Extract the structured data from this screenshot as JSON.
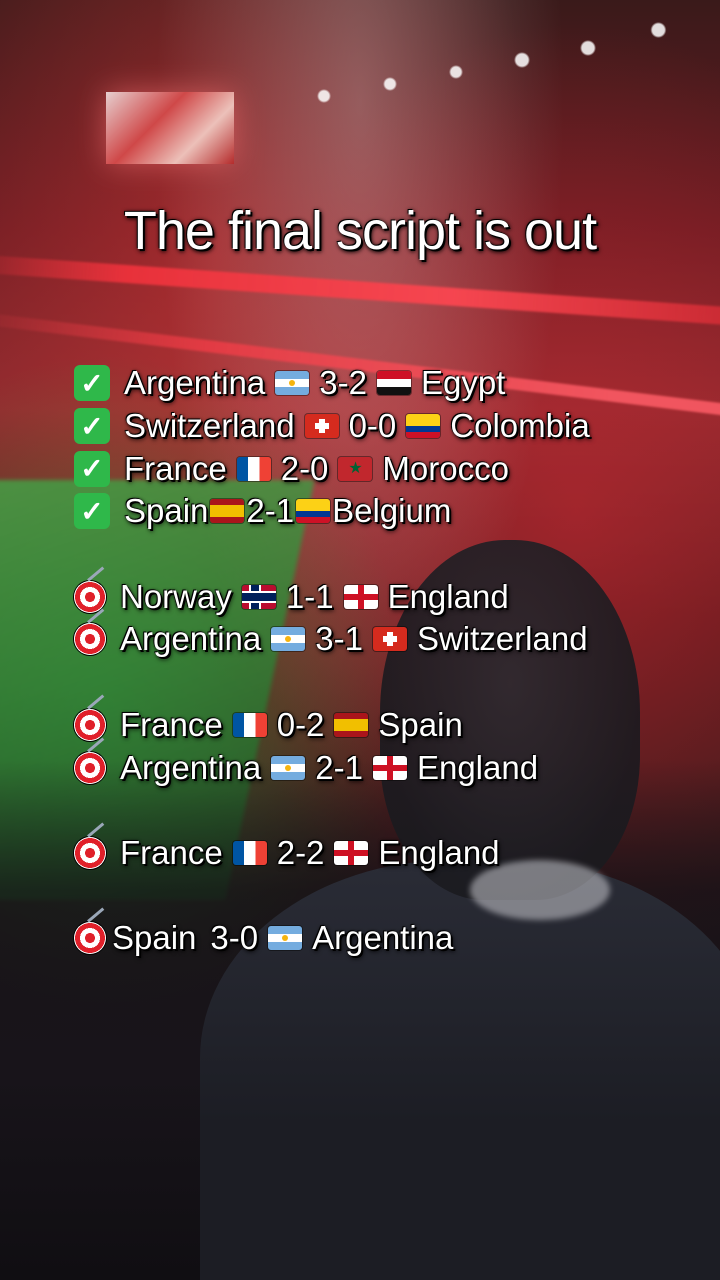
{
  "title": "The final script is out",
  "completed": [
    {
      "home": "Argentina",
      "home_flag": "flag-argentina",
      "score": "3-2",
      "away": "Egypt",
      "away_flag": "flag-egypt"
    },
    {
      "home": "Switzerland",
      "home_flag": "flag-switzerland",
      "score": "0-0",
      "away": "Colombia",
      "away_flag": "flag-colombia"
    },
    {
      "home": "France",
      "home_flag": "flag-france",
      "score": "2-0",
      "away": "Morocco",
      "away_flag": "flag-morocco"
    },
    {
      "home": "Spain",
      "home_flag": "flag-spain",
      "score": "2-1",
      "away": "Belgium",
      "away_flag": "flag-colombia"
    }
  ],
  "predictions": {
    "quarterfinals": [
      {
        "home": "Norway",
        "home_flag": "flag-norway",
        "score": "1-1",
        "away": "England",
        "away_flag": "flag-england"
      },
      {
        "home": "Argentina",
        "home_flag": "flag-argentina",
        "score": "3-1",
        "away": "Switzerland",
        "away_flag": "flag-switzerland"
      }
    ],
    "semifinals": [
      {
        "home": "France",
        "home_flag": "flag-france",
        "score": "0-2",
        "away": "Spain",
        "away_flag": "flag-spain"
      },
      {
        "home": "Argentina",
        "home_flag": "flag-argentina",
        "score": "2-1",
        "away": "England",
        "away_flag": "flag-england"
      }
    ],
    "third_place": [
      {
        "home": "France",
        "home_flag": "flag-france",
        "score": "2-2",
        "away": "England",
        "away_flag": "flag-england"
      }
    ],
    "final": [
      {
        "home": "Spain",
        "score": "3-0",
        "away": "Argentina",
        "away_flag": "flag-argentina"
      }
    ]
  },
  "icons": {
    "completed": "check-mark-icon",
    "prediction": "direct-hit-target-icon"
  },
  "colors": {
    "text": "#ffffff",
    "check": "#2fb84a",
    "target_red": "#e0202a"
  }
}
